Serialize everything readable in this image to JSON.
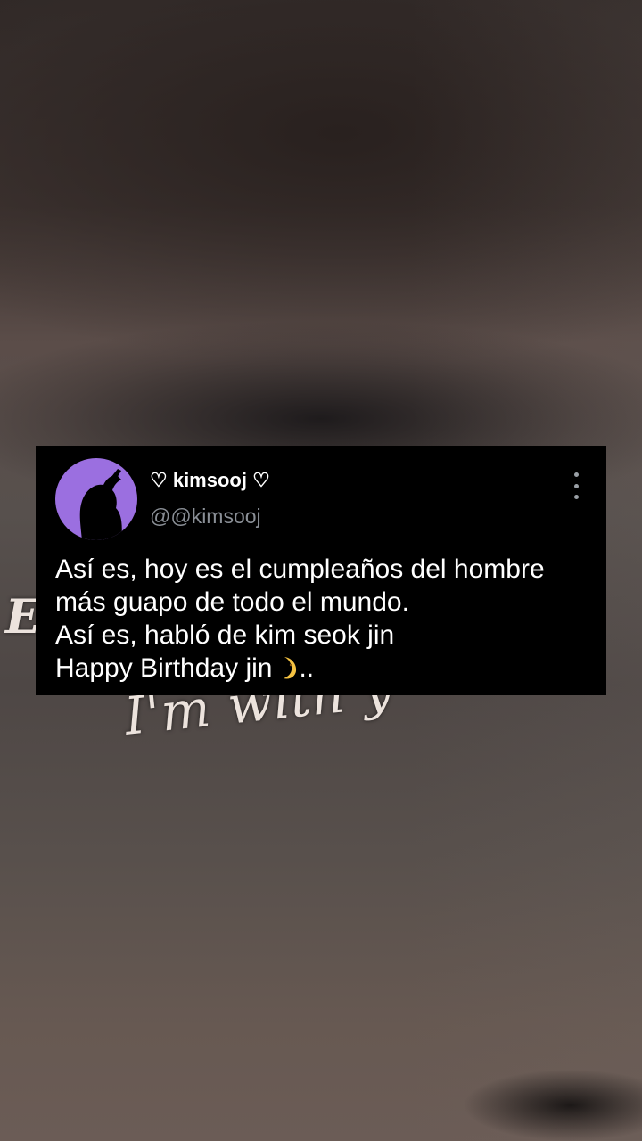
{
  "background": {
    "overlay_text_left": "E",
    "overlay_text_main": "I'm with y"
  },
  "tweet": {
    "display_name": "♡ kimsooj ♡",
    "handle": "@@kimsooj",
    "menu_icon": "more-vertical-icon",
    "body_lines": [
      "Así es, hoy es el cumpleaños del hombre",
      "más guapo de todo el mundo.",
      "Así es, habló de kim seok jin",
      "Happy Birthday jin"
    ],
    "last_line_suffix": "..",
    "emoji_icon": "crescent-moon-icon",
    "colors": {
      "card_background": "#000000",
      "avatar_background": "#9b6fe0",
      "handle_text": "#8a8f96",
      "body_text": "#ffffff"
    }
  }
}
